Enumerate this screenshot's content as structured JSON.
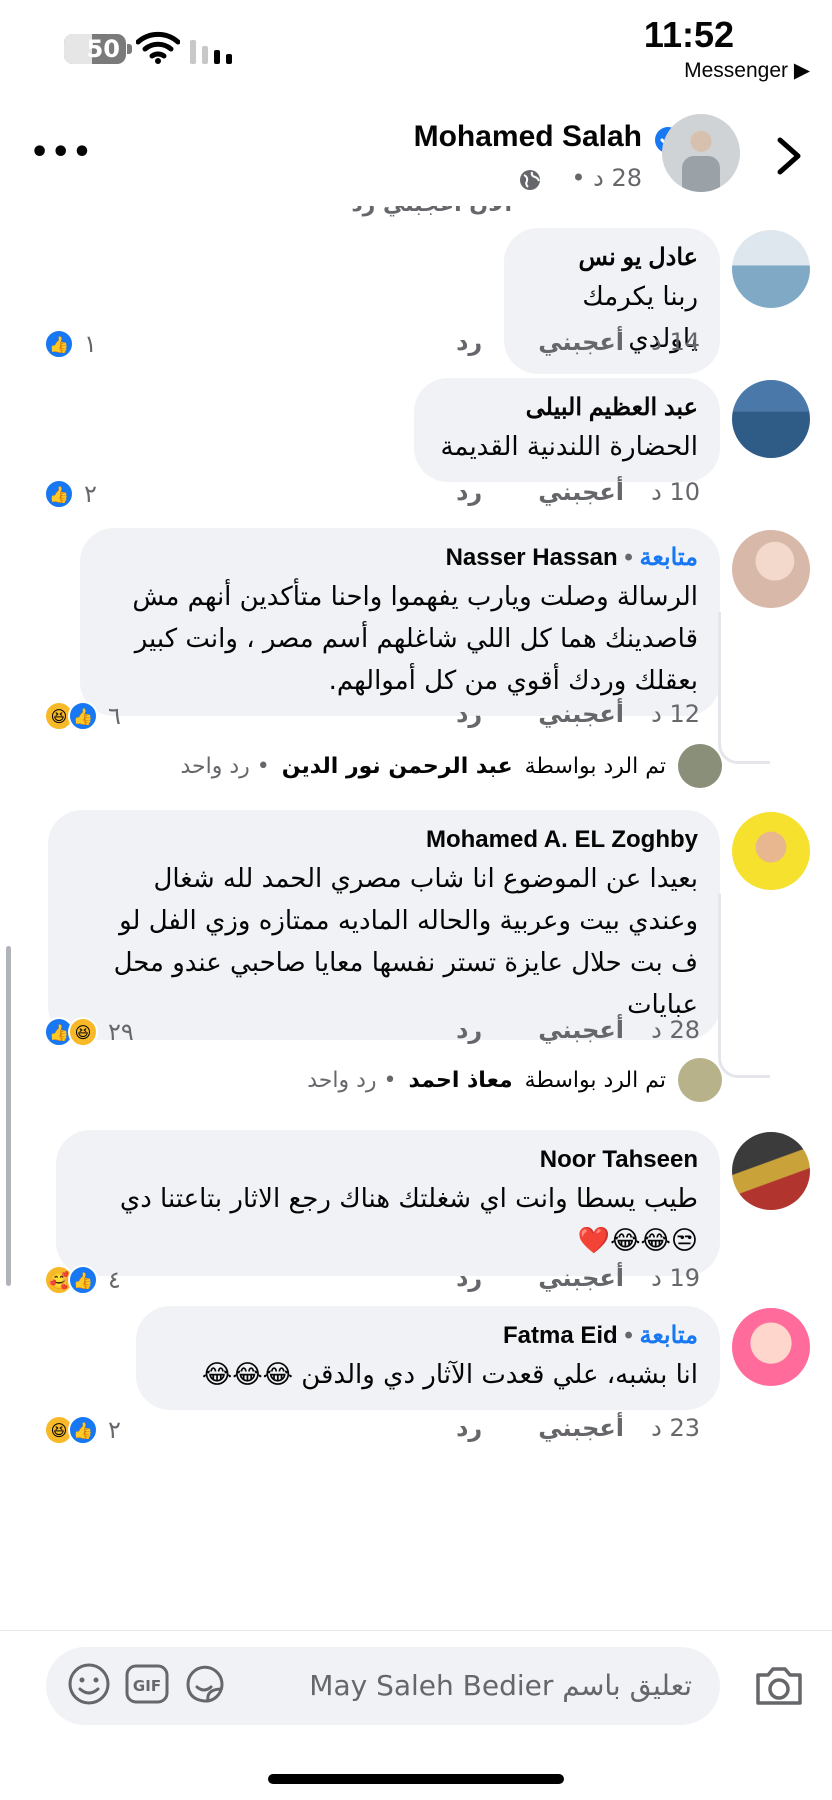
{
  "status_bar": {
    "battery": "50",
    "time": "11:52",
    "back_app": "Messenger ▶"
  },
  "header": {
    "poster_name": "Mohamed Salah",
    "post_meta": "28 د •"
  },
  "cut_row": {
    "label": "الآن   أعجبني   رد"
  },
  "comments": [
    {
      "author": "عادل يو نس",
      "text": [
        "ربنا يكرمك ياولدي"
      ],
      "time": "14 د",
      "like": "أعجبني",
      "reply": "رد",
      "reactions": [
        "like"
      ],
      "reaction_count": "١"
    },
    {
      "author": "عبد العظيم البيلى",
      "text": [
        "الحضارة اللندنية القديمة"
      ],
      "time": "10 د",
      "like": "أعجبني",
      "reply": "رد",
      "reactions": [
        "like"
      ],
      "reaction_count": "٢"
    },
    {
      "author": "Nasser Hassan",
      "follow": "متابعة",
      "text": [
        "الرسالة وصلت ويارب يفهموا واحنا متأكدين أنهم مش",
        "قاصدينك هما كل اللي شاغلهم أسم مصر ، وانت كبير",
        "بعقلك وردك أقوي من كل أموالهم."
      ],
      "time": "12 د",
      "like": "أعجبني",
      "reply": "رد",
      "reactions": [
        "like",
        "haha"
      ],
      "reaction_count": "٦",
      "reply_summary": {
        "prefix": "تم الرد بواسطة",
        "name": "عبد الرحمن نور الدين",
        "suffix": "• رد واحد"
      }
    },
    {
      "author": "Mohamed A. EL Zoghby",
      "text": [
        "بعيدا عن الموضوع انا شاب مصري الحمد لله شغال",
        "وعندي بيت  وعربية  والحاله الماديه ممتازه وزي الفل  لو",
        "ف بت حلال عايزة تستر نفسها معايا صاحبي عندو محل",
        "عبايات"
      ],
      "time": "28 د",
      "like": "أعجبني",
      "reply": "رد",
      "reactions": [
        "haha",
        "like"
      ],
      "reaction_count": "٢٩",
      "reply_summary": {
        "prefix": "تم الرد بواسطة",
        "name": "معاذ احمد",
        "suffix": "• رد واحد"
      }
    },
    {
      "author": "Noor Tahseen",
      "text": [
        "طيب يسطا وانت اي شغلتك هناك رجع الاثار بتاعتنا دي",
        "😒😂😂❤️"
      ],
      "time": "19 د",
      "like": "أعجبني",
      "reply": "رد",
      "reactions": [
        "like",
        "care"
      ],
      "reaction_count": "٤"
    },
    {
      "author": "Fatma Eid",
      "follow": "متابعة",
      "text": [
        "انا بشبه، علي قعدت الآثار دي والدقن 😂😂😂"
      ],
      "time": "23 د",
      "like": "أعجبني",
      "reply": "رد",
      "reactions": [
        "like",
        "haha"
      ],
      "reaction_count": "٢"
    }
  ],
  "composer": {
    "placeholder": "تعليق باسم May Saleh Bedier"
  },
  "icons": {
    "status": [
      "wifi-icon",
      "signal-icon"
    ],
    "header": [
      "more-icon",
      "verified-icon",
      "globe-icon",
      "chevron-right-icon"
    ],
    "composer": [
      "emoji-icon",
      "gif-icon",
      "sticker-icon",
      "camera-icon"
    ]
  },
  "colors": {
    "link": "#1877f2",
    "bubble": "#f0f2f5",
    "muted": "#65676b"
  }
}
